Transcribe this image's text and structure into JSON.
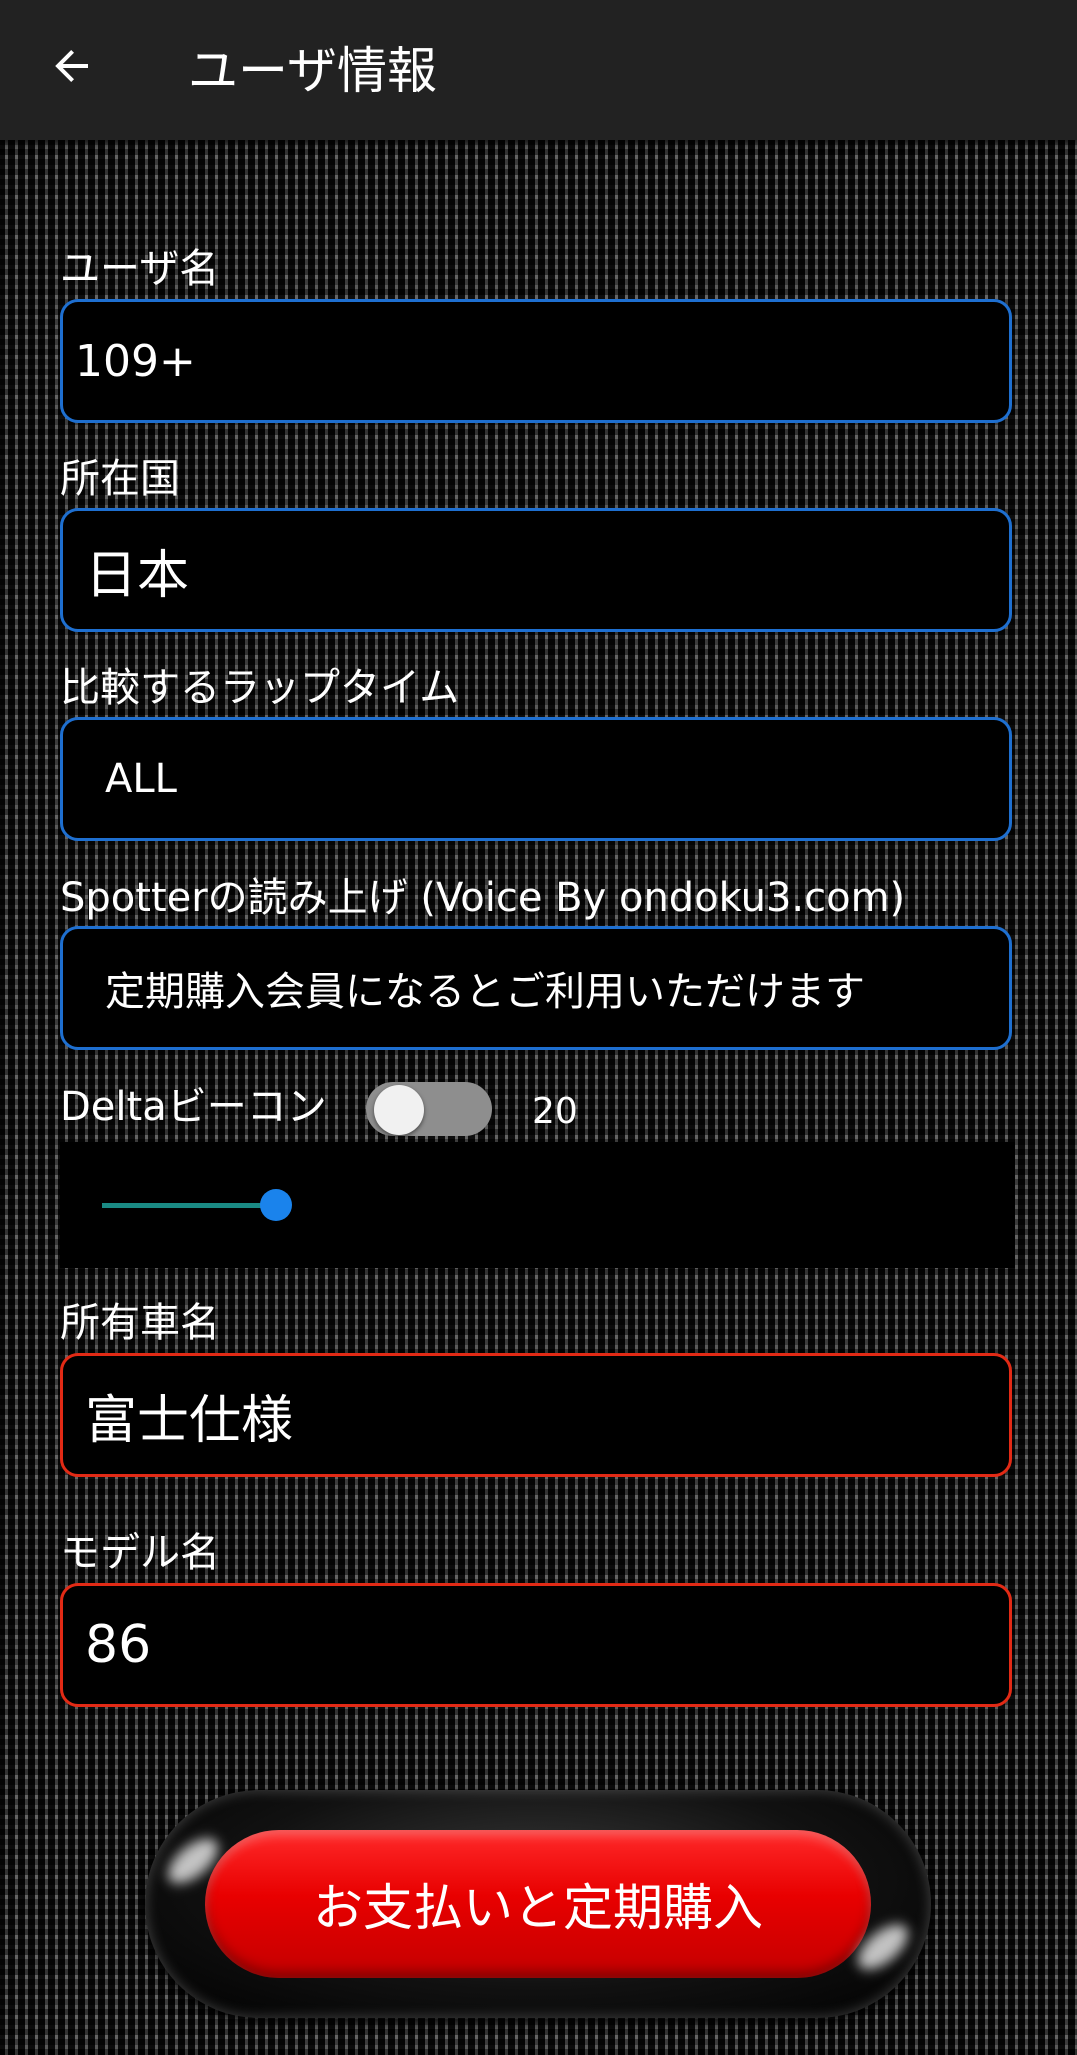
{
  "app_bar": {
    "title": "ユーザ情報",
    "back_icon": "arrow-back-icon"
  },
  "fields": {
    "user_name": {
      "label": "ユーザ名",
      "value": "109+"
    },
    "country": {
      "label": "所在国",
      "value": "日本"
    },
    "lap_compare": {
      "label": "比較するラップタイム",
      "value": "ALL"
    },
    "spotter": {
      "label": "Spotterの読み上げ (Voice By ondoku3.com)",
      "value": "定期購入会員になるとご利用いただけます"
    },
    "car_name": {
      "label": "所有車名",
      "value": "富士仕様"
    },
    "model_name": {
      "label": "モデル名",
      "value": "86"
    }
  },
  "delta_beacon": {
    "label": "Deltaビーコン",
    "enabled": false,
    "value": "20",
    "slider_fraction": 0.16
  },
  "pay_button": {
    "label": "お支払いと定期購入"
  },
  "colors": {
    "field_border_blue": "#1e6fd0",
    "field_border_red": "#e22a15",
    "slider_thumb": "#1a83ec",
    "slider_track": "#1a8a84",
    "pay_button_red": "#e80000"
  }
}
